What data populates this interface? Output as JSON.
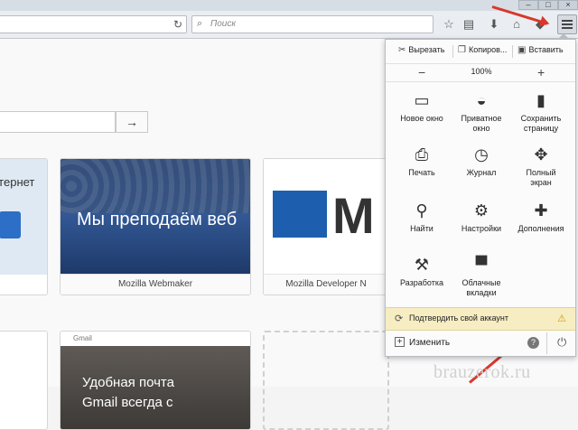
{
  "toolbar": {
    "search_placeholder": "Поиск",
    "reload_icon": "reload-icon",
    "icons": [
      "bookmark-star-icon",
      "reading-list-icon",
      "download-icon",
      "home-icon",
      "pocket-icon",
      "hamburger-menu-icon"
    ]
  },
  "page": {
    "go_icon": "→",
    "tiles": [
      {
        "caption": "",
        "text": "нтернет"
      },
      {
        "caption": "Mozilla Webmaker",
        "text": "Мы преподаём веб"
      },
      {
        "caption": "Mozilla Developer N",
        "text": "M"
      },
      {
        "caption": "",
        "text": ""
      },
      {
        "caption": "",
        "text": "Удобная почта",
        "text2": "Gmail всегда с",
        "label": "Gmail"
      }
    ]
  },
  "menu": {
    "edit": {
      "cut": "Вырезать",
      "copy": "Копиров...",
      "paste": "Вставить"
    },
    "zoom": {
      "minus": "−",
      "value": "100%",
      "plus": "+"
    },
    "items": [
      {
        "label": "Новое окно",
        "icon": "new-window-icon"
      },
      {
        "label": "Приватное окно",
        "icon": "private-mask-icon"
      },
      {
        "label": "Сохранить страницу",
        "icon": "save-page-icon"
      },
      {
        "label": "Печать",
        "icon": "print-icon"
      },
      {
        "label": "Журнал",
        "icon": "history-clock-icon"
      },
      {
        "label": "Полный экран",
        "icon": "fullscreen-icon"
      },
      {
        "label": "Найти",
        "icon": "find-magnifier-icon"
      },
      {
        "label": "Настройки",
        "icon": "settings-gear-icon"
      },
      {
        "label": "Дополнения",
        "icon": "addons-puzzle-icon"
      },
      {
        "label": "Разработка",
        "icon": "developer-wrench-icon"
      },
      {
        "label": "Облачные вкладки",
        "icon": "synced-tabs-icon"
      }
    ],
    "sync_text": "Подтвердить свой аккаунт",
    "customize": "Изменить"
  },
  "watermark": "brauzerok.ru",
  "colors": {
    "arrow": "#d9372c",
    "sync_bg": "#f7edc2",
    "accent": "#1d5fae"
  }
}
